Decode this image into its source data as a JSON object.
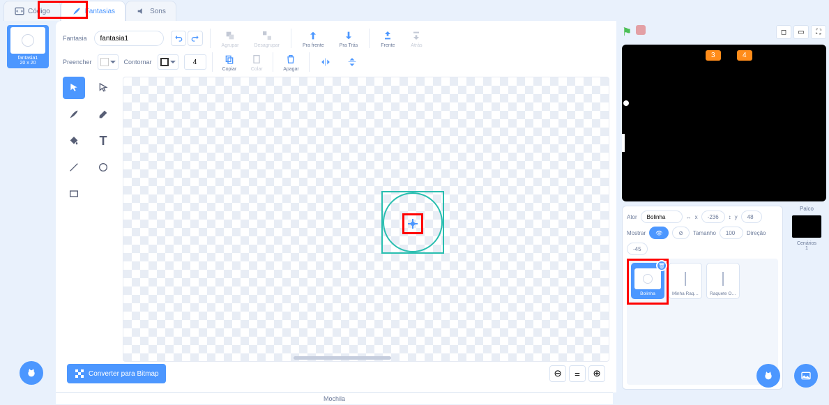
{
  "tabs": {
    "code": "Código",
    "costumes": "Fantasias",
    "sounds": "Sons"
  },
  "costume_thumb": {
    "name": "fantasia1",
    "size": "20 x 20"
  },
  "editor": {
    "costume_label": "Fantasia",
    "costume_name": "fantasia1",
    "group": "Agrupar",
    "ungroup": "Desagrupar",
    "forward": "Pra frente",
    "backward": "Pra Trás",
    "front": "Frente",
    "back": "Atrás",
    "fill": "Preencher",
    "outline": "Contornar",
    "stroke_width": "4",
    "copy": "Copiar",
    "paste": "Colar",
    "delete": "Apagar",
    "flip_h": "",
    "flip_v": "",
    "bitmap_btn": "Converter para Bitmap"
  },
  "stage_badges": {
    "left": "3",
    "right": "4"
  },
  "sprite_info": {
    "label_ator": "Ator",
    "name": "Bolinha",
    "x_label": "x",
    "x": "-236",
    "y_label": "y",
    "y": "48",
    "mostrar": "Mostrar",
    "tamanho_label": "Tamanho",
    "tamanho": "100",
    "direcao_label": "Direção",
    "direcao": "-45"
  },
  "sprites": [
    {
      "name": "Bolinha"
    },
    {
      "name": "Minha Raq…"
    },
    {
      "name": "Raquete O…"
    }
  ],
  "stage_panel": {
    "palco": "Palco",
    "cenarios": "Cenários",
    "count": "1"
  },
  "backpack": "Mochila"
}
